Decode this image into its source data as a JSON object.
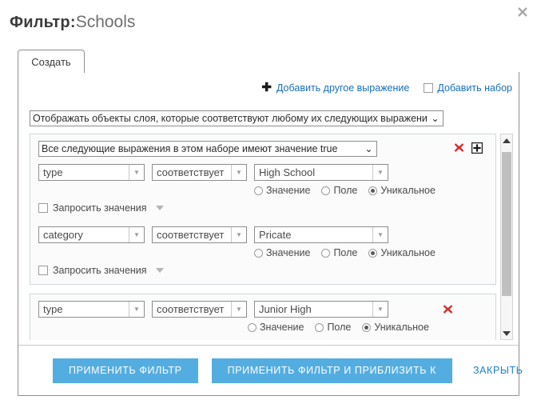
{
  "window": {
    "title_strong": "Фильтр:",
    "title_light": "Schools",
    "close_icon": "close-icon"
  },
  "tabs": [
    {
      "label": "Создать",
      "active": true
    }
  ],
  "toolbar": {
    "add_expression": {
      "icon": "plus-icon",
      "label": "Добавить другое выражение"
    },
    "add_set": {
      "icon": "checkbox-icon",
      "label": "Добавить набор"
    }
  },
  "top_select": {
    "value": "Отображать объекты слоя, которые соответствуют любому их следующих выражени",
    "caret": "⌄"
  },
  "labels": {
    "ask_values": "Запросить значения",
    "radio_value": "Значение",
    "radio_field": "Поле",
    "radio_unique": "Уникальное",
    "remove_icon": "remove-icon",
    "add_set_icon": "add-set-icon",
    "dropdown_arrow": "▾"
  },
  "sets": [
    {
      "header": "Все следующие выражения в этом наборе имеют значение true",
      "has_remove": true,
      "has_add": true,
      "expressions": [
        {
          "field": "type",
          "operator": "соответствует",
          "value": "High School",
          "source": "unique",
          "ask_values_checked": false,
          "has_remove": false
        },
        {
          "field": "category",
          "operator": "соответствует",
          "value": "Pricate",
          "source": "unique",
          "ask_values_checked": false,
          "has_remove": false
        }
      ]
    },
    {
      "header": null,
      "has_remove": false,
      "has_add": false,
      "expressions": [
        {
          "field": "type",
          "operator": "соответствует",
          "value": "Junior High",
          "source": "unique",
          "ask_values_checked": false,
          "has_remove": true
        }
      ]
    }
  ],
  "scrollbar": {
    "up_icon": "scroll-up-icon",
    "down_icon": "scroll-down-icon"
  },
  "footer": {
    "apply": "ПРИМЕНИТЬ ФИЛЬТР",
    "apply_zoom": "ПРИМЕНИТЬ ФИЛЬТР И ПРИБЛИЗИТЬ К",
    "close": "ЗАКРЫТЬ"
  },
  "colors": {
    "accent_blue": "#54ade0",
    "link_blue": "#1a6fb8",
    "remove_red": "#d42a2a",
    "panel_border": "#909090"
  }
}
